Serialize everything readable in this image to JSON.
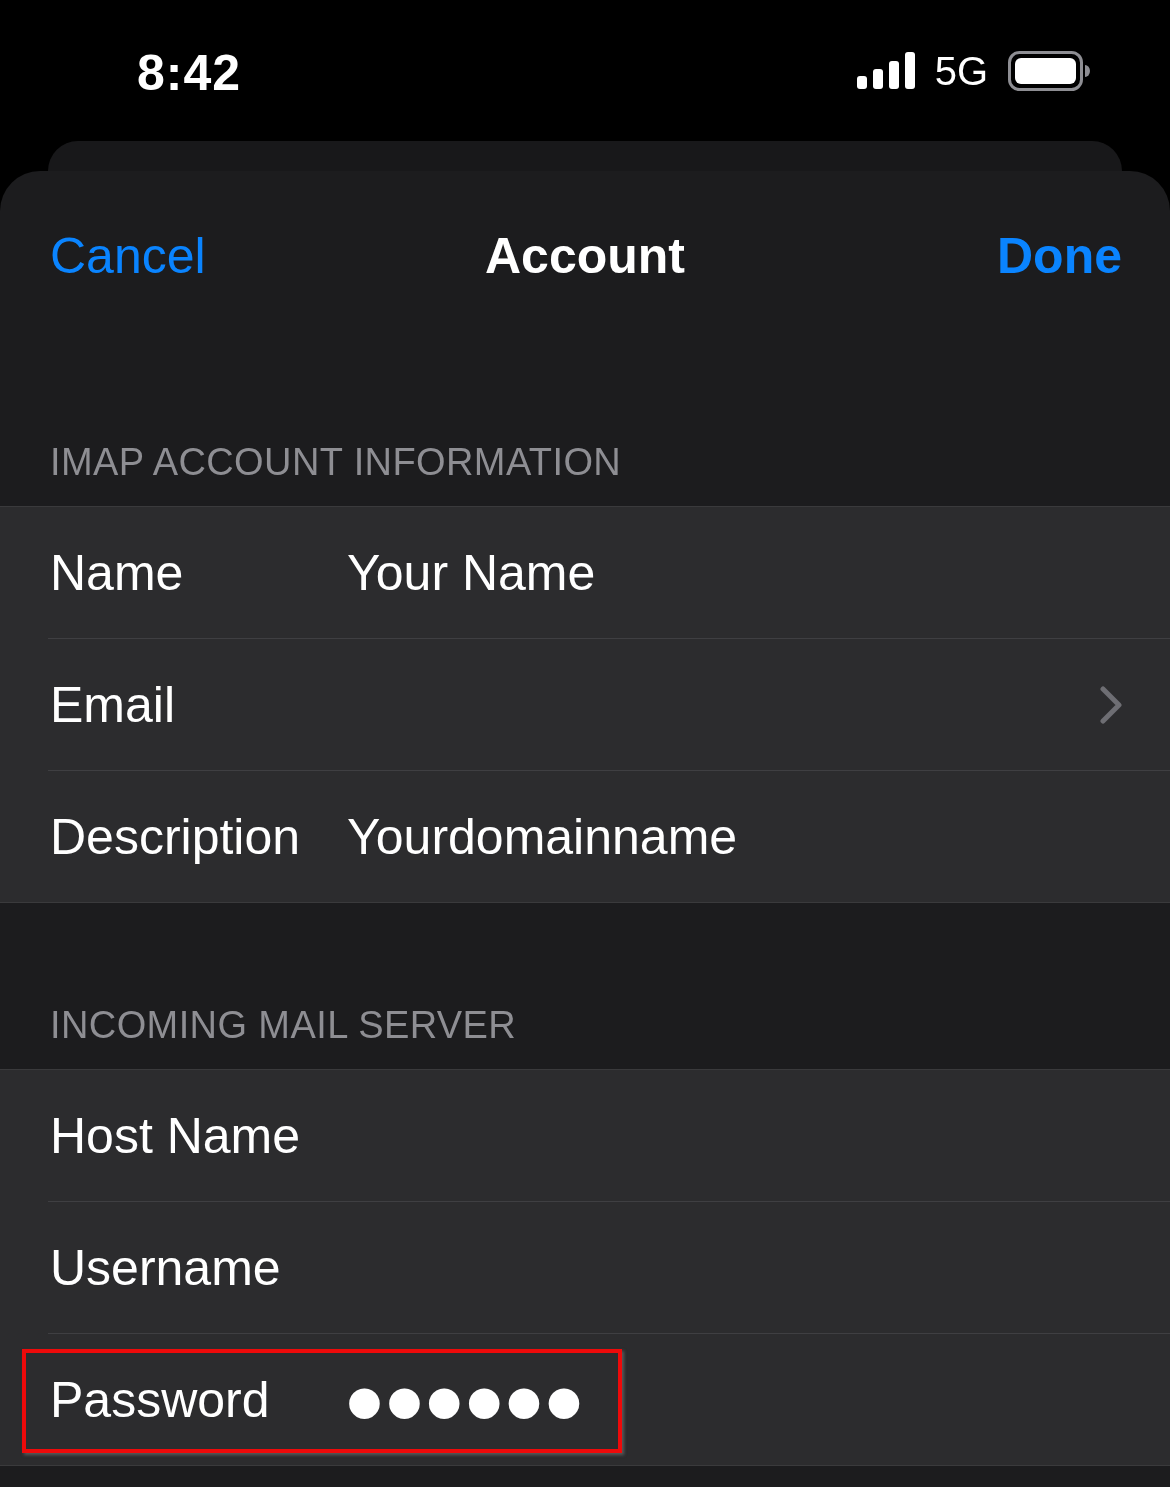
{
  "status_bar": {
    "time": "8:42",
    "network": "5G"
  },
  "nav": {
    "cancel": "Cancel",
    "title": "Account",
    "done": "Done"
  },
  "sections": [
    {
      "header": "IMAP ACCOUNT INFORMATION",
      "rows": [
        {
          "kind": "field",
          "label": "Name",
          "value": "Your Name",
          "highlighted": false
        },
        {
          "kind": "disclosure",
          "label": "Email",
          "highlighted": false
        },
        {
          "kind": "field",
          "label": "Description",
          "value": "Yourdomainname",
          "highlighted": false
        }
      ]
    },
    {
      "header": "INCOMING MAIL SERVER",
      "rows": [
        {
          "kind": "field",
          "label": "Host Name",
          "highlighted": false
        },
        {
          "kind": "field",
          "label": "Username",
          "highlighted": false
        },
        {
          "kind": "field",
          "label": "Password",
          "value": "●●●●●●",
          "highlighted": true
        }
      ]
    }
  ]
}
